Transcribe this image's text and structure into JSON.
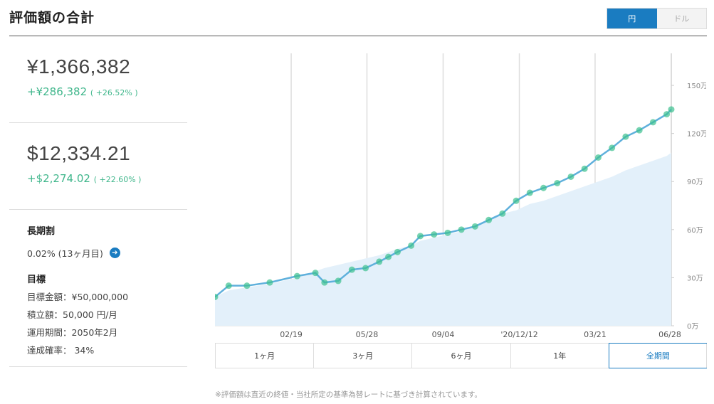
{
  "header": {
    "title": "評価額の合計"
  },
  "currency_toggle": {
    "jpy": "円",
    "usd": "ドル"
  },
  "summary": {
    "jpy": {
      "value": "¥1,366,382",
      "gain": "+¥286,382",
      "gain_pct": "( +26.52% )"
    },
    "usd": {
      "value": "$12,334.21",
      "gain": "+$2,274.02",
      "gain_pct": "( +22.60% )"
    }
  },
  "long_term": {
    "heading": "長期割",
    "text": "0.02% (13ヶ月目)"
  },
  "goal": {
    "heading": "目標",
    "rows": [
      "目標金額：¥50,000,000",
      "積立額：50,000 円/月",
      "運用期間：2050年2月",
      "達成確率： 34%"
    ]
  },
  "period_tabs": [
    "1ヶ月",
    "3ヶ月",
    "6ヶ月",
    "1年",
    "全期間"
  ],
  "active_period": "全期間",
  "footnote": "※評価額は直近の終値・当社所定の基準為替レートに基づき計算されています。",
  "colors": {
    "accent": "#1a7cc1",
    "gain": "#3fb68b",
    "line": "#5fb0dc",
    "area": "#e3f0fa",
    "marker": "#3cc08e"
  },
  "chart_data": {
    "type": "area",
    "x_tick_labels": [
      "02/19",
      "05/28",
      "09/04",
      "'20/12/12",
      "03/21",
      "06/28"
    ],
    "y_tick_labels": [
      "0万",
      "30万",
      "60万",
      "90万",
      "120万",
      "150万"
    ],
    "ylim": [
      0,
      170
    ],
    "y_unit": "万円",
    "series": [
      {
        "x": [
          0,
          3,
          7,
          12,
          18,
          22,
          24,
          27,
          30,
          33,
          36,
          38,
          40,
          43,
          45,
          48,
          51,
          54,
          57,
          60,
          63,
          66,
          69,
          72,
          75,
          78,
          81,
          84,
          87,
          90,
          93,
          96,
          99,
          100
        ],
        "values": [
          18,
          25,
          25,
          27,
          31,
          33,
          27,
          28,
          35,
          36,
          40,
          43,
          46,
          50,
          56,
          57,
          58,
          60,
          62,
          66,
          70,
          78,
          83,
          86,
          89,
          93,
          98,
          105,
          111,
          118,
          122,
          127,
          132,
          135
        ]
      },
      {
        "x": [
          0,
          3,
          7,
          12,
          18,
          23,
          24,
          27,
          30,
          33,
          36,
          38,
          40,
          43,
          45,
          48,
          51,
          54,
          57,
          60,
          63,
          66,
          69,
          72,
          75,
          78,
          81,
          84,
          87,
          90,
          93,
          96,
          99,
          100
        ],
        "values": [
          18,
          22,
          24,
          26,
          30,
          35,
          36,
          38,
          40,
          42,
          44,
          46,
          48,
          50,
          53,
          55,
          57,
          59,
          62,
          66,
          70,
          72,
          76,
          78,
          81,
          84,
          87,
          90,
          93,
          97,
          100,
          103,
          106,
          108
        ]
      }
    ]
  }
}
